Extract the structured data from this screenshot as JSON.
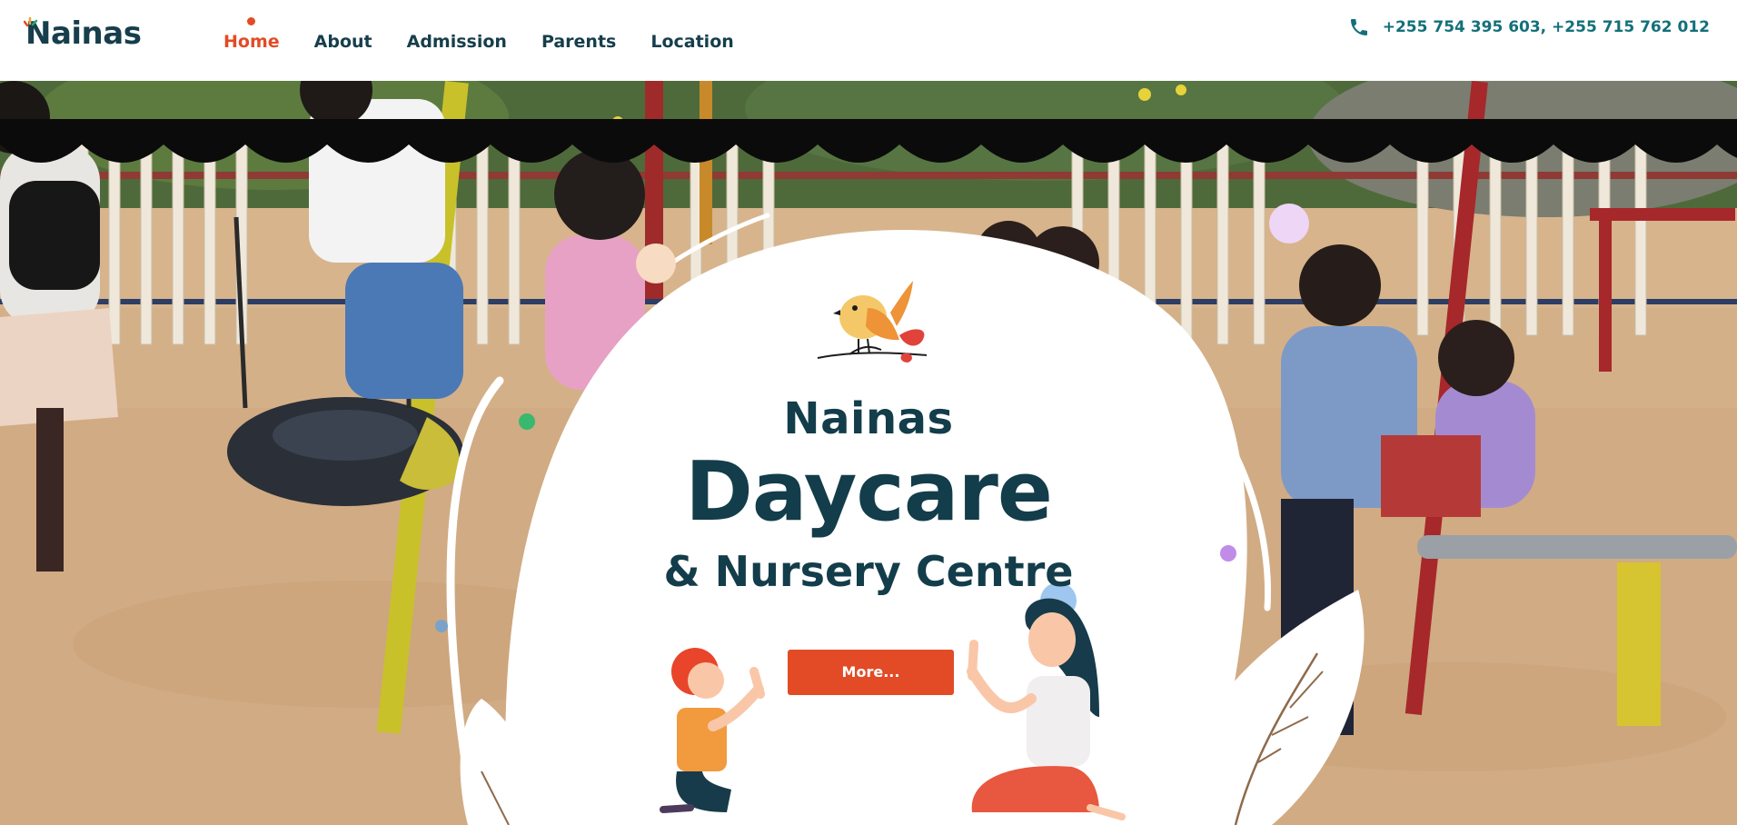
{
  "brand": {
    "name": "Nainas"
  },
  "nav": {
    "items": [
      {
        "label": "Home",
        "active": true
      },
      {
        "label": "About",
        "active": false
      },
      {
        "label": "Admission",
        "active": false
      },
      {
        "label": "Parents",
        "active": false
      },
      {
        "label": "Location",
        "active": false
      }
    ]
  },
  "contact": {
    "icon": "phone-icon",
    "phones": "+255 754 395 603, +255 715 762 012"
  },
  "hero": {
    "title_line1": "Nainas",
    "title_line2": "Daycare",
    "title_line3": "& Nursery Centre",
    "button_label": "More..."
  },
  "colors": {
    "accent": "#e24b26",
    "brand_dark": "#163e4c",
    "phone_teal": "#13707a"
  }
}
